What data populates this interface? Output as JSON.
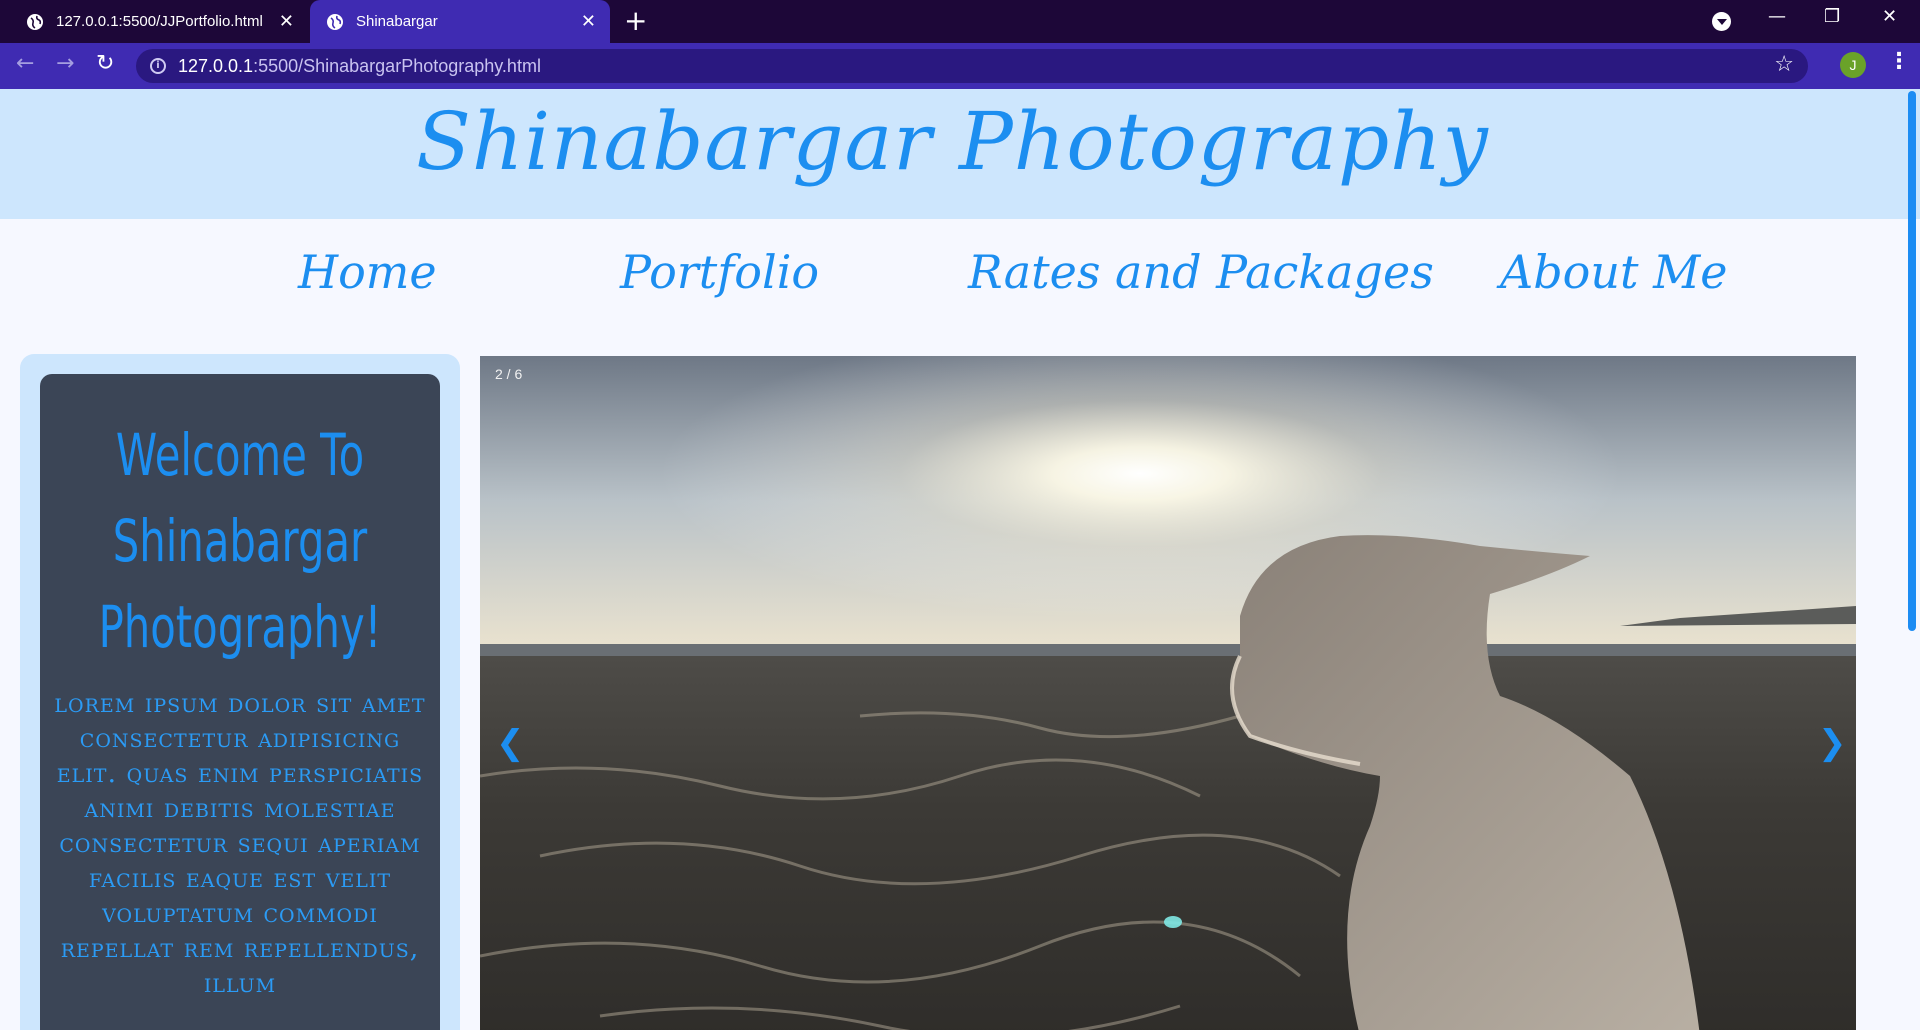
{
  "browser": {
    "tabs": [
      {
        "title": "127.0.0.1:5500/JJPortfolio.html",
        "active": false
      },
      {
        "title": "Shinabargar",
        "active": true
      }
    ],
    "url_host": "127.0.0.1",
    "url_rest": ":5500/ShinabargarPhotography.html",
    "profile_initial": "J",
    "icons": {
      "globe": "globe-icon",
      "close": "close-icon",
      "new_tab": "plus-icon",
      "back": "arrow-left-icon",
      "forward": "arrow-right-icon",
      "reload": "reload-icon",
      "info": "info-icon",
      "bookmark": "star-icon",
      "menu": "kebab-menu-icon"
    }
  },
  "site": {
    "title": "Shinabargar Photography",
    "nav": [
      "Home",
      "Portfolio",
      "Rates and Packages",
      "About Me"
    ],
    "welcome": "Welcome To Shinabargar Photography!",
    "lorem": "Lorem ipsum dolor sit amet consectetur adipisicing elit. Quas enim perspiciatis animi debitis molestiae consectetur sequi aperiam facilis eaque est velit voluptatum commodi repellat rem repellendus, illum",
    "slideshow": {
      "counter": "2 / 6",
      "prev": "❮",
      "next": "❯",
      "current": 2,
      "total": 6
    }
  },
  "colors": {
    "accent": "#1c8ef0",
    "header_band": "#cde6fd",
    "card": "#3b4556",
    "browser_frame": "#1d0738",
    "browser_toolbar": "#3f2bb2"
  }
}
